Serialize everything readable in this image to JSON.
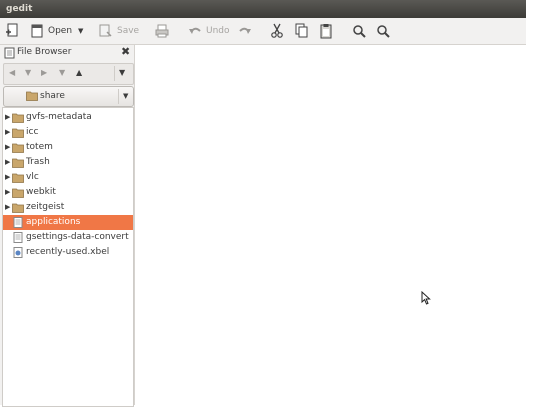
{
  "window": {
    "title": "gedit"
  },
  "toolbar": {
    "open_label": "Open",
    "save_label": "Save",
    "undo_label": "Undo"
  },
  "side_panel": {
    "title": "File Browser",
    "location": "share",
    "items": [
      {
        "name": "gvfs-metadata",
        "type": "folder",
        "expandable": true,
        "selected": false
      },
      {
        "name": "icc",
        "type": "folder",
        "expandable": true,
        "selected": false
      },
      {
        "name": "totem",
        "type": "folder",
        "expandable": true,
        "selected": false
      },
      {
        "name": "Trash",
        "type": "folder",
        "expandable": true,
        "selected": false
      },
      {
        "name": "vlc",
        "type": "folder",
        "expandable": true,
        "selected": false
      },
      {
        "name": "webkit",
        "type": "folder",
        "expandable": true,
        "selected": false
      },
      {
        "name": "zeitgeist",
        "type": "folder",
        "expandable": true,
        "selected": false
      },
      {
        "name": "applications",
        "type": "file",
        "expandable": false,
        "selected": true
      },
      {
        "name": "gsettings-data-convert",
        "type": "file",
        "expandable": false,
        "selected": false
      },
      {
        "name": "recently-used.xbel",
        "type": "xml-file",
        "expandable": false,
        "selected": false
      }
    ]
  },
  "colors": {
    "selection": "#f07746",
    "titlebar": "#3c3b37",
    "folder": "#c9a66b"
  }
}
